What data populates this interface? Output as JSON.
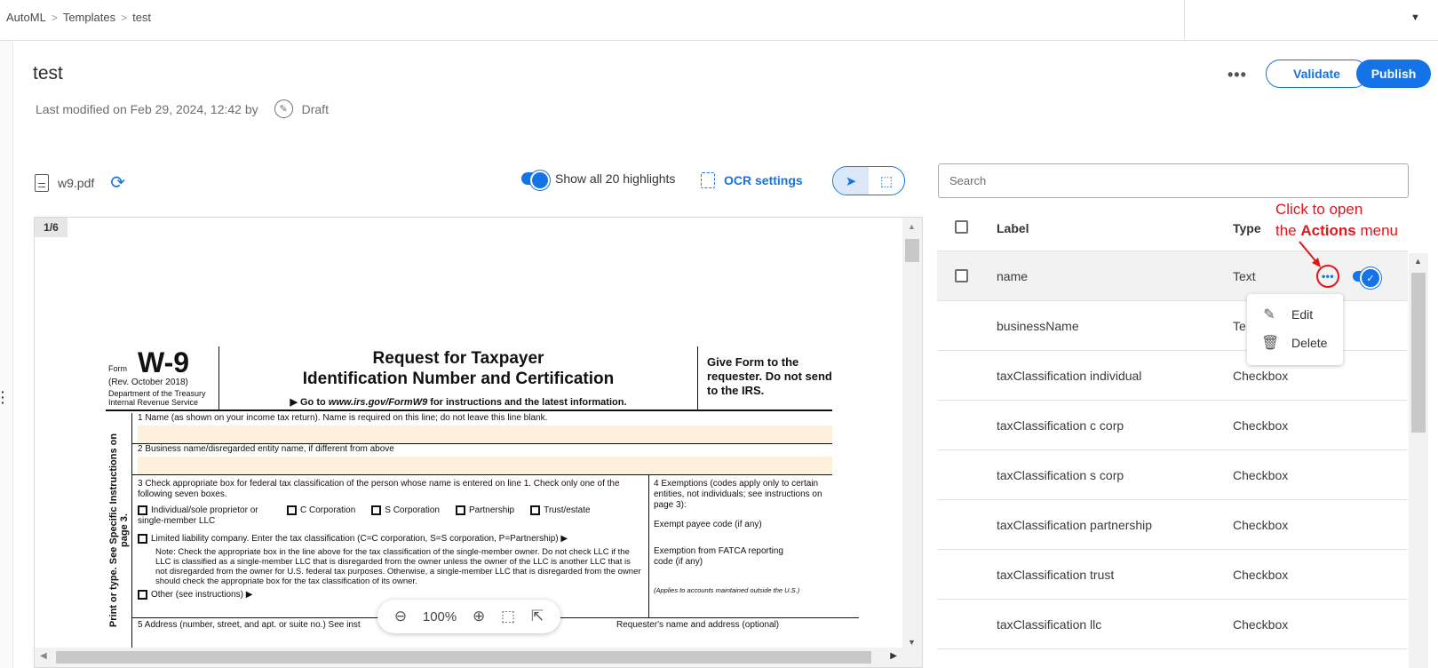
{
  "breadcrumb": [
    "AutoML",
    "Templates",
    "test"
  ],
  "page": {
    "title": "test",
    "modified": "Last modified on Feb 29, 2024, 12:42 by",
    "status": "Draft"
  },
  "header_actions": {
    "validate": "Validate",
    "publish": "Publish"
  },
  "file": {
    "name": "w9.pdf"
  },
  "highlights_toggle": "Show all 20 highlights",
  "ocr_settings": "OCR settings",
  "viewer": {
    "page_indicator": "1/6",
    "zoom": "100%"
  },
  "form": {
    "form_word": "Form",
    "w9": "W-9",
    "rev": "(Rev. October 2018)",
    "dept": "Department of the Treasury",
    "irs": "Internal Revenue Service",
    "title1": "Request for Taxpayer",
    "title2": "Identification Number and Certification",
    "goto_prefix": "▶ Go to",
    "goto_url": "www.irs.gov/FormW9",
    "goto_suffix": "for instructions and the latest information.",
    "give": "Give Form to the requester. Do not send to the IRS.",
    "side": "Print or type. See Specific Instructions on page 3.",
    "line1": "1  Name (as shown on your income tax return). Name is required on this line; do not leave this line blank.",
    "line2": "2  Business name/disregarded entity name, if different from above",
    "line3": "3  Check appropriate box for federal tax classification of the person whose name is entered on line 1. Check only one of the following seven boxes.",
    "opt_individual": "Individual/sole proprietor or single-member LLC",
    "opt_ccorp": "C Corporation",
    "opt_scorp": "S Corporation",
    "opt_partnership": "Partnership",
    "opt_trust": "Trust/estate",
    "opt_llc": "Limited liability company. Enter the tax classification (C=C corporation, S=S corporation, P=Partnership) ▶",
    "note": "Note: Check the appropriate box in the line above for the tax classification of the single-member owner. Do not check LLC if the LLC is classified as a single-member LLC that is disregarded from the owner unless the owner of the LLC is another LLC that is not disregarded from the owner for U.S. federal tax purposes. Otherwise, a single-member LLC that is disregarded from the owner should check the appropriate box for the tax classification of its owner.",
    "opt_other": "Other (see instructions) ▶",
    "box4": "4  Exemptions (codes apply only to certain entities, not individuals; see instructions on page 3):",
    "exempt_payee": "Exempt payee code (if any)",
    "fatca": "Exemption from FATCA reporting code (if any)",
    "applies": "(Applies to accounts maintained outside the U.S.)",
    "line5": "5  Address (number, street, and apt. or suite no.) See inst",
    "requester": "Requester's name and address (optional)"
  },
  "search": {
    "placeholder": "Search"
  },
  "table": {
    "headers": {
      "label": "Label",
      "type": "Type"
    },
    "rows": [
      {
        "label": "name",
        "type": "Text"
      },
      {
        "label": "businessName",
        "type": "Te"
      },
      {
        "label": "taxClassification individual",
        "type": "Checkbox"
      },
      {
        "label": "taxClassification c corp",
        "type": "Checkbox"
      },
      {
        "label": "taxClassification s corp",
        "type": "Checkbox"
      },
      {
        "label": "taxClassification partnership",
        "type": "Checkbox"
      },
      {
        "label": "taxClassification trust",
        "type": "Checkbox"
      },
      {
        "label": "taxClassification llc",
        "type": "Checkbox"
      }
    ]
  },
  "actions_menu": {
    "edit": "Edit",
    "delete": "Delete"
  },
  "annotation": {
    "line1": "Click to open",
    "line2_prefix": "the",
    "line2_bold": "Actions",
    "line2_suffix": "menu"
  },
  "colors": {
    "accent": "#1473e6",
    "annotation": "#e3151a",
    "form_fill": "#fdf1de"
  }
}
